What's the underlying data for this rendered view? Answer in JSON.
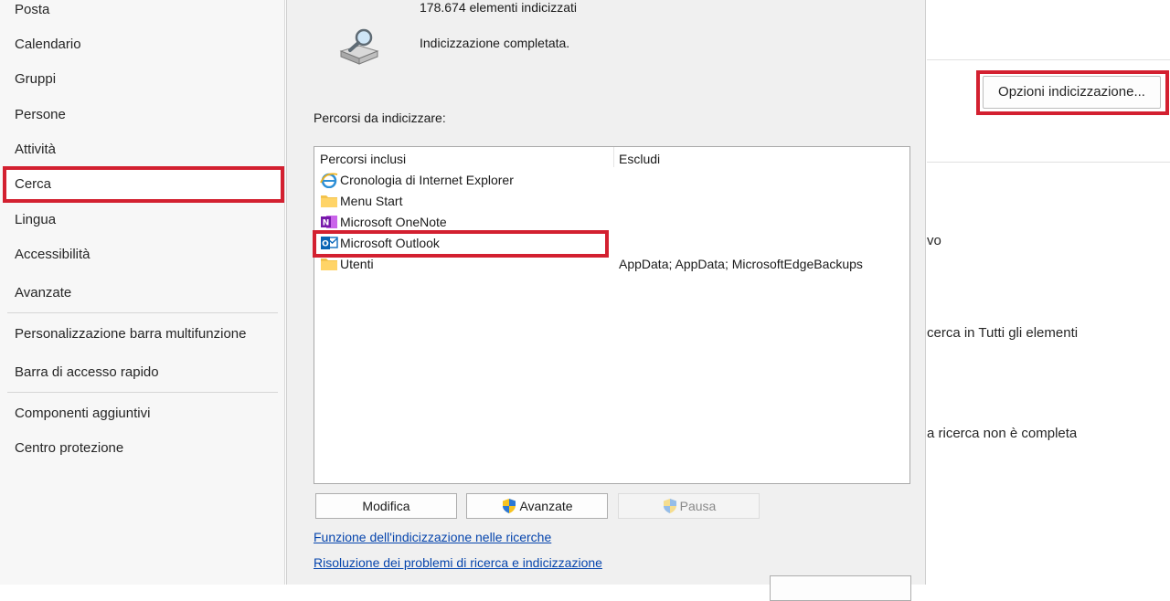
{
  "nav": {
    "items": [
      "Posta",
      "Calendario",
      "Gruppi",
      "Persone",
      "Attività",
      "Cerca",
      "Lingua",
      "Accessibilità",
      "Avanzate",
      "Personalizzazione barra multifunzione",
      "Barra di accesso rapido",
      "Componenti aggiuntivi",
      "Centro protezione"
    ],
    "selected": "Cerca"
  },
  "options": {
    "indexing_button": "Opzioni indicizzazione...",
    "partial_text_1": "vo",
    "partial_text_2": "cerca in Tutti gli elementi",
    "partial_text_3": "a ricerca non è completa"
  },
  "dialog": {
    "items_count": "178.674 elementi indicizzati",
    "status": "Indicizzazione completata.",
    "locations_label": "Percorsi da indicizzare:",
    "columns": {
      "included": "Percorsi inclusi",
      "exclude": "Escludi"
    },
    "rows": [
      {
        "name": "Cronologia di Internet Explorer",
        "exclude": "",
        "icon": "internet-explorer-icon"
      },
      {
        "name": "Menu Start",
        "exclude": "",
        "icon": "folder-icon"
      },
      {
        "name": "Microsoft OneNote",
        "exclude": "",
        "icon": "onenote-icon"
      },
      {
        "name": "Microsoft Outlook",
        "exclude": "",
        "icon": "outlook-icon"
      },
      {
        "name": "Utenti",
        "exclude": "AppData; AppData; MicrosoftEdgeBackups",
        "icon": "folder-icon"
      }
    ],
    "buttons": {
      "modify": "Modifica",
      "advanced": "Avanzate",
      "pause": "Pausa"
    },
    "links": {
      "how_indexing": "Funzione dell'indicizzazione nelle ricerche",
      "troubleshoot": "Risoluzione dei problemi di ricerca e indicizzazione"
    }
  },
  "colors": {
    "highlight": "#d32030",
    "link": "#0645ad"
  }
}
